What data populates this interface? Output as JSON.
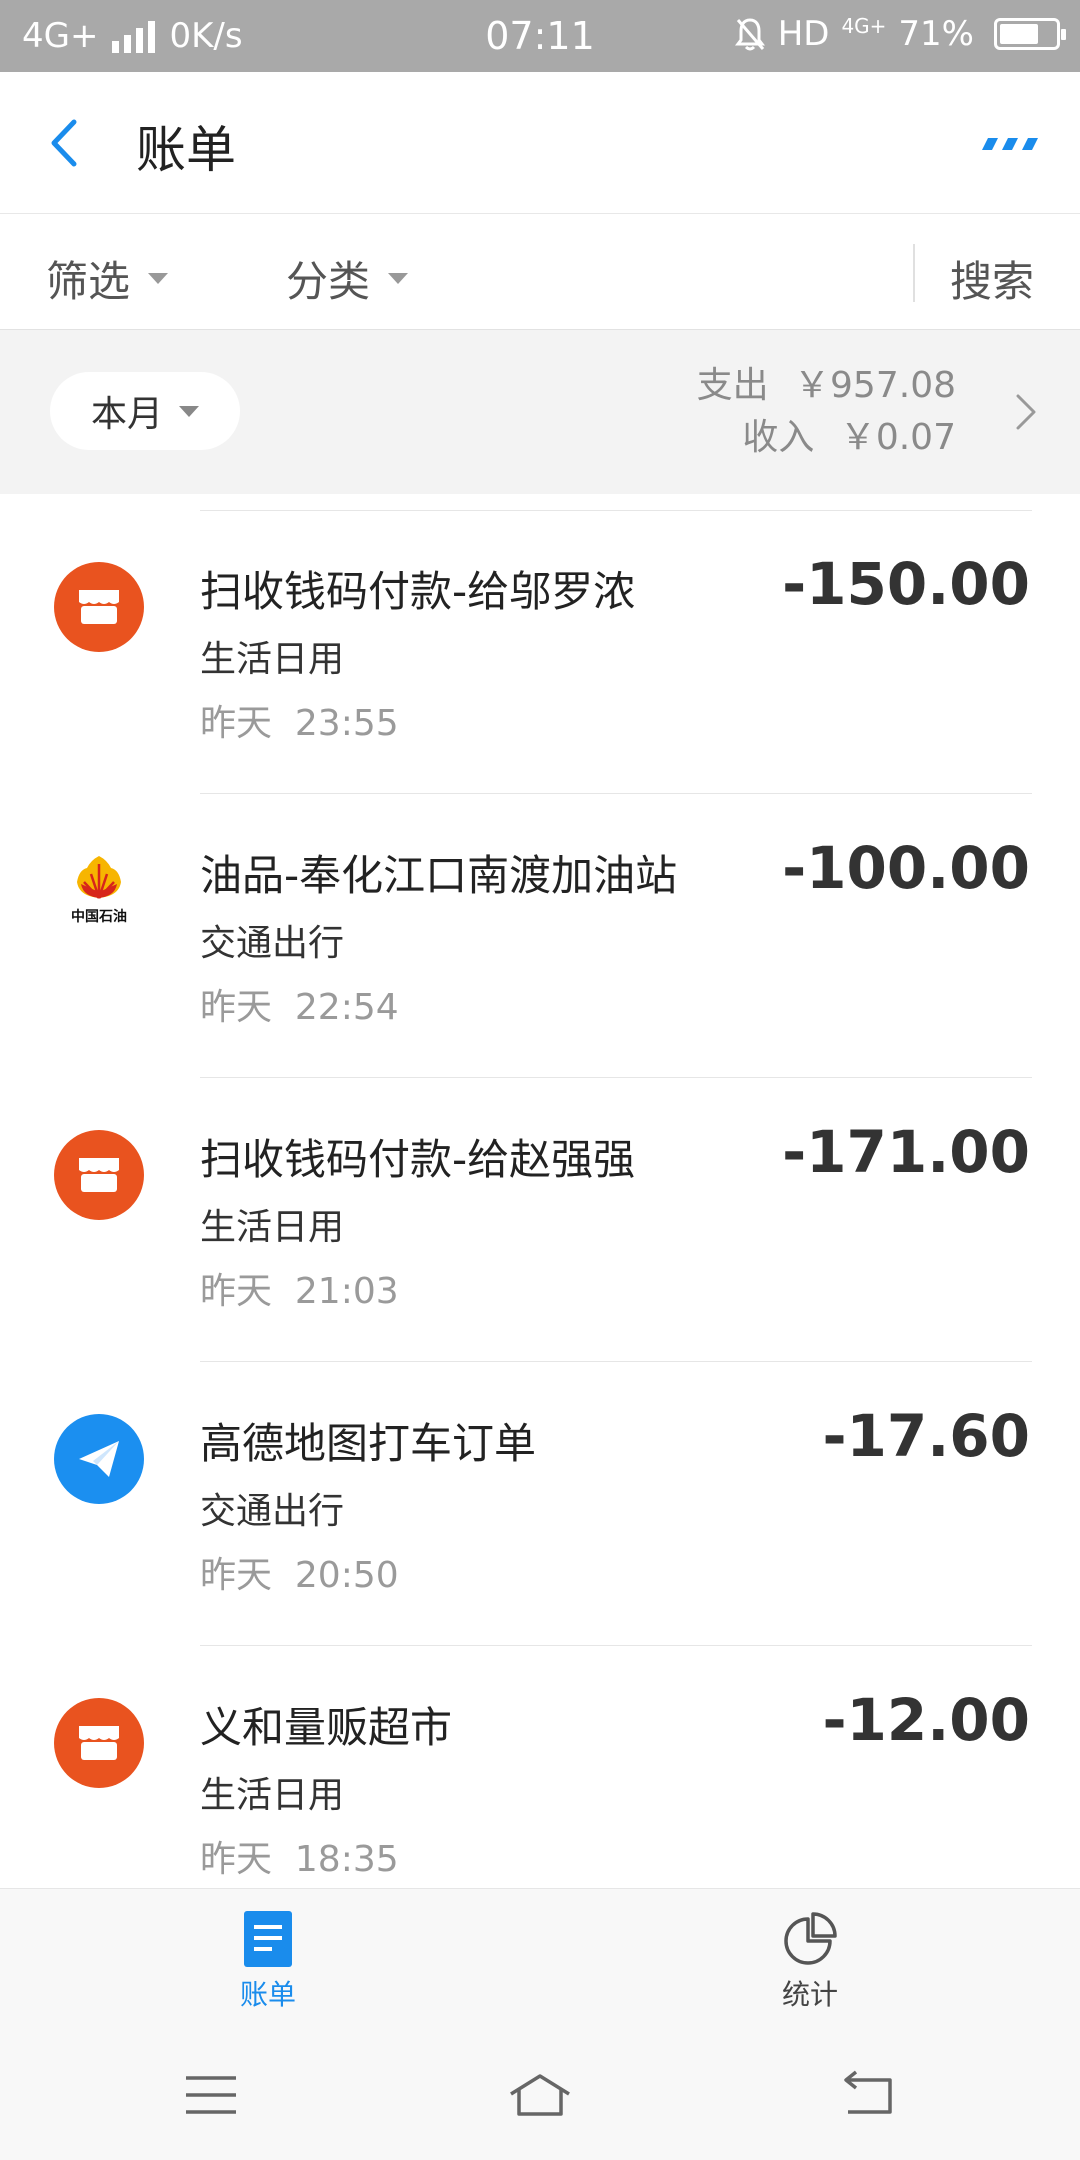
{
  "status_bar": {
    "network": "4G+",
    "speed": "0K/s",
    "time": "07:11",
    "hd": "HD",
    "network2": "4G+",
    "battery": "71%",
    "battery_level": 0.71
  },
  "header": {
    "title": "账单"
  },
  "filters": {
    "filter": "筛选",
    "category": "分类",
    "search": "搜索"
  },
  "month": {
    "selector": "本月",
    "expense_label": "支出",
    "expense_value": "￥957.08",
    "income_label": "收入",
    "income_value": "￥0.07"
  },
  "transactions": [
    {
      "icon": "shop-icon",
      "title": "扫收钱码付款-给邬罗浓",
      "category": "生活日用",
      "day": "昨天",
      "time": "23:55",
      "amount": "-150.00"
    },
    {
      "icon": "petrochina-logo",
      "title": "油品-奉化江口南渡加油站",
      "category": "交通出行",
      "day": "昨天",
      "time": "22:54",
      "amount": "-100.00",
      "logo_text": "中国石油"
    },
    {
      "icon": "shop-icon",
      "title": "扫收钱码付款-给赵强强",
      "category": "生活日用",
      "day": "昨天",
      "time": "21:03",
      "amount": "-171.00"
    },
    {
      "icon": "paper-plane-icon",
      "title": "高德地图打车订单",
      "category": "交通出行",
      "day": "昨天",
      "time": "20:50",
      "amount": "-17.60"
    },
    {
      "icon": "shop-icon",
      "title": "义和量贩超市",
      "category": "生活日用",
      "day": "昨天",
      "time": "18:35",
      "amount": "-12.00"
    }
  ],
  "tabs": {
    "bills": "账单",
    "stats": "统计"
  },
  "colors": {
    "accent": "#1a8cec",
    "shop": "#e9531f",
    "navigation": "#1b8ff0"
  }
}
